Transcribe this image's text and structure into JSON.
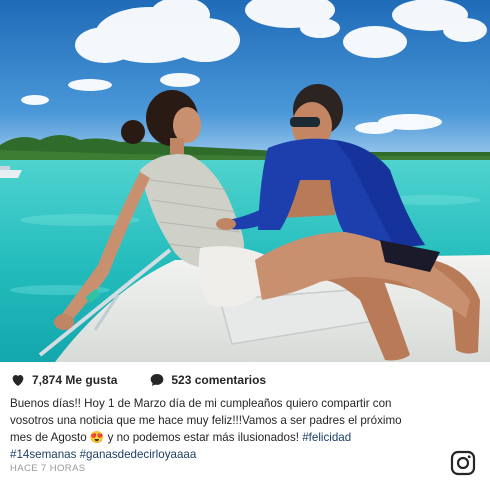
{
  "post": {
    "image_alt": "Couple sitting on the bow of a boat on turquoise water",
    "likes": "7,874 Me gusta",
    "comments": "523 comentarios",
    "caption_lines": [
      "Buenos días!! Hoy 1 de Marzo día de mi cumpleaños quiero compartir con",
      "vosotros una noticia que me hace muy feliz!!!Vamos a ser padres el próximo",
      "mes de Agosto 😍 y no podemos estar más ilusionados! #felicidad",
      "#14semanas #ganasdedecirloyaaaa"
    ],
    "timestamp": "HACE 7 HORAS",
    "icons": {
      "like": "heart-icon",
      "comment": "comment-bubble-icon",
      "brand": "instagram-icon"
    },
    "colors": {
      "hashtag": "#1e3f66",
      "sea": "#36c9c8",
      "sky": "#2f78c4"
    }
  }
}
